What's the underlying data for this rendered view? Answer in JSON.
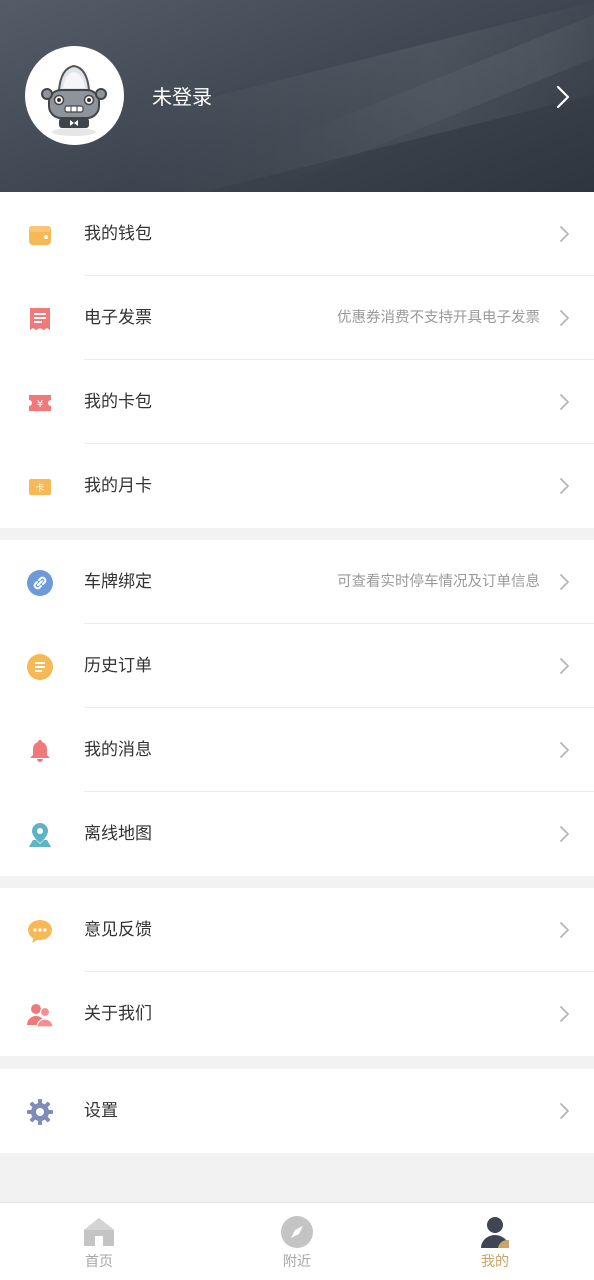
{
  "header": {
    "login_label": "未登录"
  },
  "groups": [
    {
      "items": [
        {
          "name": "wallet",
          "label": "我的钱包",
          "hint": "",
          "icon": "wallet-icon",
          "color": "#f7b955"
        },
        {
          "name": "invoice",
          "label": "电子发票",
          "hint": "优惠券消费不支持开具电子发票",
          "icon": "receipt-icon",
          "color": "#f07a79"
        },
        {
          "name": "card-pack",
          "label": "我的卡包",
          "hint": "",
          "icon": "coupon-icon",
          "color": "#f07a79"
        },
        {
          "name": "monthly-card",
          "label": "我的月卡",
          "hint": "",
          "icon": "card-icon",
          "color": "#f7b955"
        }
      ]
    },
    {
      "items": [
        {
          "name": "plate-binding",
          "label": "车牌绑定",
          "hint": "可查看实时停车情况及订单信息",
          "icon": "link-icon",
          "color": "#6f9ad9"
        },
        {
          "name": "order-history",
          "label": "历史订单",
          "hint": "",
          "icon": "list-icon",
          "color": "#f7b955"
        },
        {
          "name": "messages",
          "label": "我的消息",
          "hint": "",
          "icon": "bell-icon",
          "color": "#f07a79"
        },
        {
          "name": "offline-map",
          "label": "离线地图",
          "hint": "",
          "icon": "map-pin-icon",
          "color": "#5fb3c4"
        }
      ]
    },
    {
      "items": [
        {
          "name": "feedback",
          "label": "意见反馈",
          "hint": "",
          "icon": "chat-icon",
          "color": "#f7b955"
        },
        {
          "name": "about-us",
          "label": "关于我们",
          "hint": "",
          "icon": "people-icon",
          "color": "#f07a79"
        }
      ]
    },
    {
      "items": [
        {
          "name": "settings",
          "label": "设置",
          "hint": "",
          "icon": "gear-icon",
          "color": "#7d8db5"
        }
      ]
    }
  ],
  "tabbar": {
    "tabs": [
      {
        "name": "home",
        "label": "首页",
        "icon": "home-icon",
        "active": false
      },
      {
        "name": "nearby",
        "label": "附近",
        "icon": "compass-icon",
        "active": false
      },
      {
        "name": "mine",
        "label": "我的",
        "icon": "user-icon",
        "active": true
      }
    ],
    "active_color": "#c9a46a",
    "inactive_color": "#a8a8a8"
  }
}
